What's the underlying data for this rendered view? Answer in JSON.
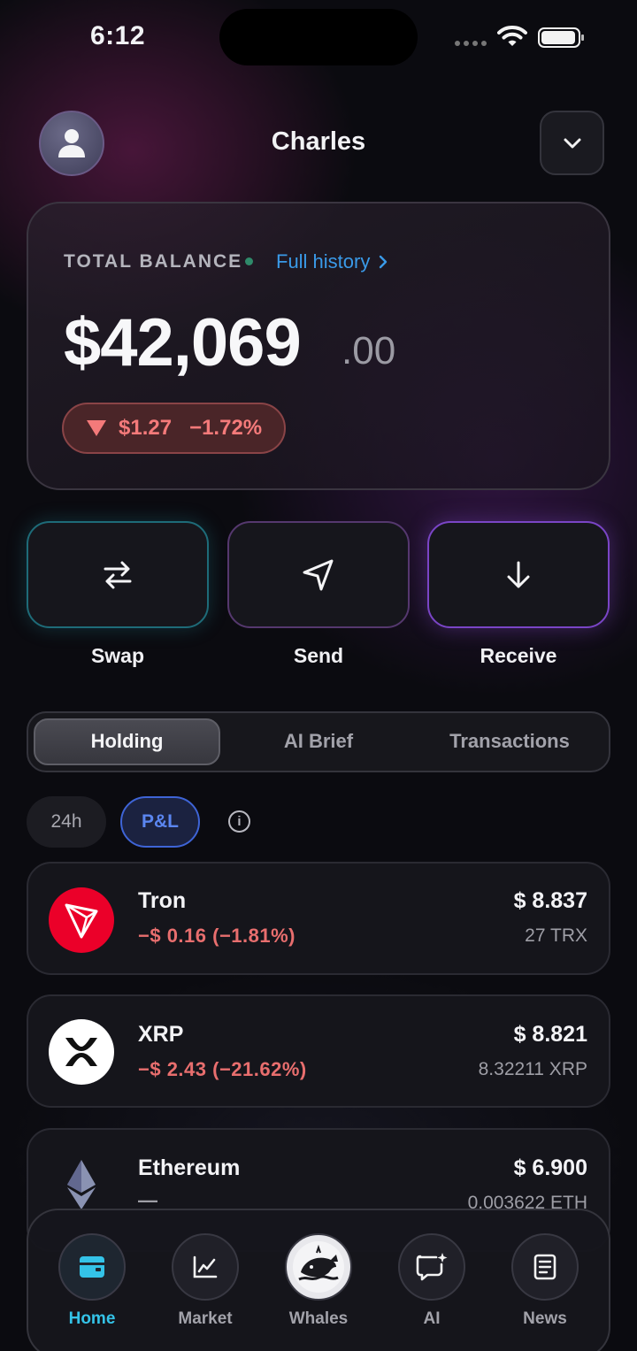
{
  "status_bar": {
    "time": "6:12"
  },
  "header": {
    "user_name": "Charles"
  },
  "balance": {
    "label": "TOTAL BALANCE",
    "history_link": "Full history",
    "amount_main": "$42,069",
    "amount_cents": ".00",
    "change_value": "$1.27",
    "change_percent": "−1.72%",
    "change_color": "#f47a7a"
  },
  "actions": [
    {
      "label": "Swap",
      "icon": "swap-arrows-icon"
    },
    {
      "label": "Send",
      "icon": "send-icon"
    },
    {
      "label": "Receive",
      "icon": "arrow-down-icon"
    }
  ],
  "tabs": {
    "items": [
      "Holding",
      "AI Brief",
      "Transactions"
    ],
    "active": "Holding"
  },
  "filters": {
    "chip_24h": "24h",
    "chip_pl": "P&L",
    "active": "P&L",
    "info_icon": "info-icon"
  },
  "holdings": [
    {
      "name": "Tron",
      "pnl": "−$ 0.16 (−1.81%)",
      "value": "$ 8.837",
      "quantity": "27 TRX",
      "icon": "tron-logo-icon",
      "icon_color": "#eb0029"
    },
    {
      "name": "XRP",
      "pnl": "−$ 2.43 (−21.62%)",
      "value": "$ 8.821",
      "quantity": "8.32211 XRP",
      "icon": "xrp-logo-icon",
      "icon_color": "#ffffff"
    },
    {
      "name": "Ethereum",
      "pnl": "—",
      "value": "$ 6.900",
      "quantity": "0.003622 ETH",
      "icon": "ethereum-logo-icon",
      "icon_color": "#8a92b2"
    }
  ],
  "bottom_nav": {
    "items": [
      {
        "label": "Home",
        "icon": "wallet-icon"
      },
      {
        "label": "Market",
        "icon": "chart-icon"
      },
      {
        "label": "Whales",
        "icon": "whale-icon"
      },
      {
        "label": "AI",
        "icon": "ai-chat-icon"
      },
      {
        "label": "News",
        "icon": "news-icon"
      }
    ],
    "active": "Home",
    "active_color": "#34c3e8"
  }
}
